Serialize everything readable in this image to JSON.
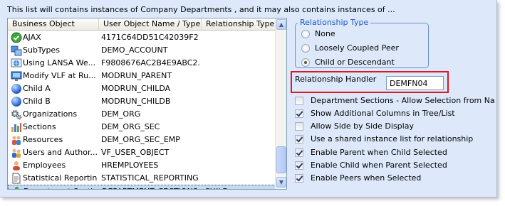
{
  "description": "This list will contains instances of Company Departments , and it may also contains instances of ...",
  "columns": [
    "Business Object",
    "User Object Name / Type",
    "Relationship Type"
  ],
  "rows": [
    {
      "icon": "green-check-icon",
      "name": "AJAX",
      "object": "4171C64DD51C42039F2...",
      "relationship": ""
    },
    {
      "icon": "subtypes-icon",
      "name": "SubTypes",
      "object": "DEMO_ACCOUNT",
      "relationship": ""
    },
    {
      "icon": "globe-icon",
      "name": "Using LANSA We...",
      "object": "F9808676AC2B4E9ABC2...",
      "relationship": ""
    },
    {
      "icon": "monitor-icon",
      "name": "Modify VLF at Ru...",
      "object": "MODRUN_PARENT",
      "relationship": ""
    },
    {
      "icon": "blue-ball-icon",
      "name": "Child A",
      "object": "MODRUN_CHILDA",
      "relationship": ""
    },
    {
      "icon": "blue-ball-icon",
      "name": "Child B",
      "object": "MODRUN_CHILDB",
      "relationship": ""
    },
    {
      "icon": "gears-icon",
      "name": "Organizations",
      "object": "DEM_ORG",
      "relationship": ""
    },
    {
      "icon": "bar-chart-icon",
      "name": "Sections",
      "object": "DEM_ORG_SEC",
      "relationship": ""
    },
    {
      "icon": "people-icon",
      "name": "Resources",
      "object": "DEM_ORG_SEC_EMP",
      "relationship": ""
    },
    {
      "icon": "users-icon",
      "name": "Users and Author...",
      "object": "VF_USER_OBJECT",
      "relationship": ""
    },
    {
      "icon": "employee-icon",
      "name": "Employees",
      "object": "HREMPLOYEES",
      "relationship": ""
    },
    {
      "icon": "document-icon",
      "name": "Statistical Reporting",
      "object": "STATISTICAL_REPORTING",
      "relationship": ""
    },
    {
      "icon": "puzzle-icon",
      "name": "Department Secti...",
      "object": "DEPARTMENT_SECTIONS",
      "relationship": "CHILD",
      "selected": true
    }
  ],
  "relationship_type": {
    "title": "Relationship Type",
    "options": [
      "None",
      "Loosely Coupled Peer",
      "Child or Descendant"
    ],
    "selected": "Child or Descendant"
  },
  "handler": {
    "label": "Relationship Handler",
    "value": "DEMFN04"
  },
  "checkboxes": [
    {
      "label": "Department Sections - Allow Selection from Navigatio",
      "checked": false
    },
    {
      "label": "Show Additional Columns in Tree/List",
      "checked": true
    },
    {
      "label": "Allow Side by Side Display",
      "checked": false
    },
    {
      "label": "Use a shared instance list for relationship",
      "checked": true
    },
    {
      "label": "Enable Parent when Child Selected",
      "checked": true
    },
    {
      "label": "Enable Child when Parent Selected",
      "checked": true
    },
    {
      "label": "Enable Peers when Selected",
      "checked": true
    }
  ],
  "scrollbar": {
    "up": "▲",
    "down": "▼"
  }
}
